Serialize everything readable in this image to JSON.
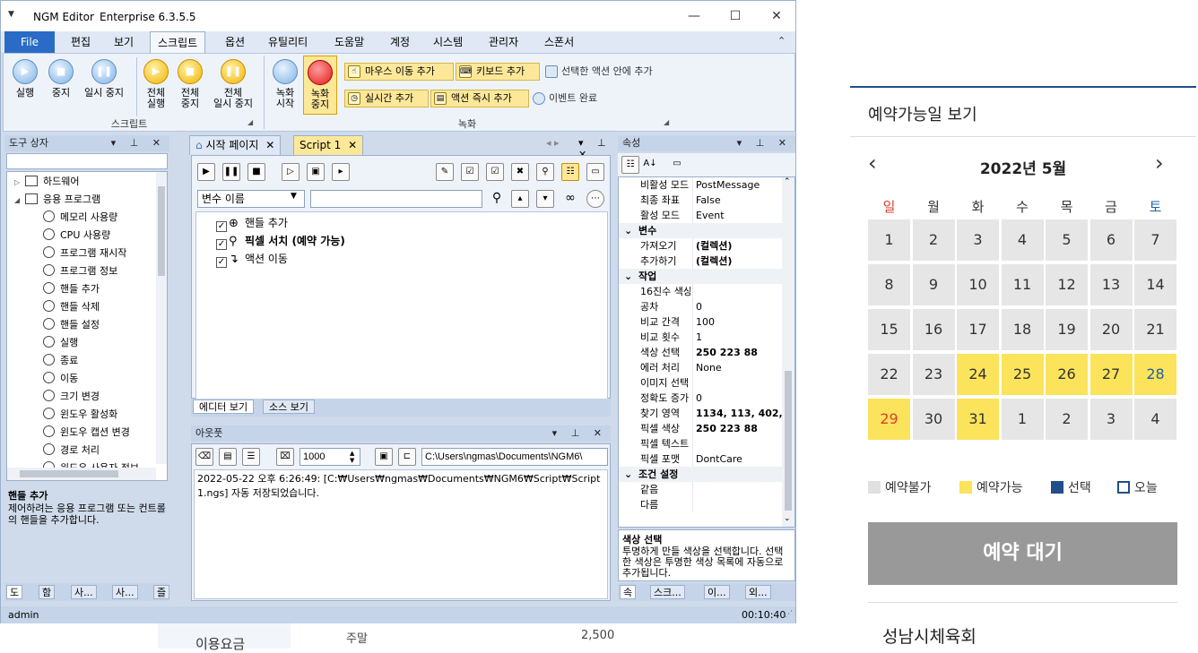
{
  "app": {
    "title": "NGM Editor",
    "edition": "Enterprise 6.3.5.5",
    "window_controls": [
      "—",
      "☐",
      "✕"
    ]
  },
  "menu": [
    "File",
    "편집",
    "보기",
    "스크립트",
    "옵션",
    "유틸리티",
    "도움말",
    "계정",
    "시스템",
    "관리자",
    "스폰서"
  ],
  "ribbon": {
    "script_group": {
      "label": "스크립트",
      "buttons": [
        {
          "line1": "실행",
          "line2": "",
          "icon": "play-icon"
        },
        {
          "line1": "중지",
          "line2": "",
          "icon": "stop-icon"
        },
        {
          "line1": "일시 중지",
          "line2": "",
          "icon": "pause-icon"
        },
        {
          "line1": "전체",
          "line2": "실행",
          "icon": "play-all-icon"
        },
        {
          "line1": "전체",
          "line2": "중지",
          "icon": "stop-all-icon"
        },
        {
          "line1": "전체",
          "line2": "일시 중지",
          "icon": "pause-all-icon"
        }
      ]
    },
    "record_group": {
      "label": "녹화",
      "start": {
        "line1": "녹화",
        "line2": "시작"
      },
      "stop": {
        "line1": "녹화",
        "line2": "중지"
      },
      "add_mouse": "마우스 이동 추가",
      "add_keyboard": "키보드 추가",
      "add_inside": "선택한 액션 안에 추가",
      "add_realtime": "실시간 추가",
      "add_instant": "액션 즉시 추가",
      "event_done": "이벤트 완료"
    }
  },
  "toolbox": {
    "title": "도구 상자",
    "items": [
      {
        "label": "하드웨어",
        "level": 0,
        "expander": "▷"
      },
      {
        "label": "응용 프로그램",
        "level": 0,
        "expander": "◢"
      },
      {
        "label": "메모리 사용량",
        "level": 1
      },
      {
        "label": "CPU 사용량",
        "level": 1
      },
      {
        "label": "프로그램 재시작",
        "level": 1
      },
      {
        "label": "프로그램 정보",
        "level": 1
      },
      {
        "label": "핸들 추가",
        "level": 1
      },
      {
        "label": "핸들 삭제",
        "level": 1
      },
      {
        "label": "핸들 설정",
        "level": 1
      },
      {
        "label": "실행",
        "level": 1
      },
      {
        "label": "종료",
        "level": 1
      },
      {
        "label": "이동",
        "level": 1
      },
      {
        "label": "크기 변경",
        "level": 1
      },
      {
        "label": "윈도우 활성화",
        "level": 1
      },
      {
        "label": "윈도우 캡션 변경",
        "level": 1
      },
      {
        "label": "경로 처리",
        "level": 1
      },
      {
        "label": "윈도우 사용자 정보",
        "level": 1
      }
    ],
    "desc_title": "핸들 추가",
    "desc_text": "제어하려는 응용 프로그램 또는 컨트롤의 핸들을 추가합니다.",
    "bottom_tabs": [
      "도",
      "함",
      "사...",
      "사...",
      "즐"
    ]
  },
  "editor": {
    "tabs": [
      "시작 페이지",
      "Script 1"
    ],
    "variable_combo": "변수 이름",
    "search_value": "",
    "actions": [
      {
        "label": "핸들 추가",
        "bold": false
      },
      {
        "label": "픽셀 서치 (예약 가능)",
        "bold": true
      },
      {
        "label": "액션 이동",
        "bold": false
      }
    ],
    "view_tabs": [
      "에디터 보기",
      "소스 보기"
    ]
  },
  "output": {
    "title": "아웃풋",
    "count": "1000",
    "path": "C:\\Users\\ngmas\\Documents\\NGM6\\",
    "log_line1": "2022-05-22 오후 6:26:49: [C:₩Users₩ngmas₩Documents₩NGM6₩Script₩Script",
    "log_line2": "1.ngs] 자동 저장되었습니다."
  },
  "properties": {
    "title": "속성",
    "rows": [
      {
        "type": "prop",
        "name": "비활성 모드",
        "value": "PostMessage"
      },
      {
        "type": "prop",
        "name": "최종 좌표",
        "value": "False"
      },
      {
        "type": "prop",
        "name": "활성 모드",
        "value": "Event"
      },
      {
        "type": "cat",
        "name": "변수"
      },
      {
        "type": "prop",
        "name": "가져오기",
        "value": "(컬렉션)",
        "bold": true
      },
      {
        "type": "prop",
        "name": "추가하기",
        "value": "(컬렉션)",
        "bold": true
      },
      {
        "type": "cat",
        "name": "작업"
      },
      {
        "type": "prop",
        "name": "16진수 색상",
        "value": ""
      },
      {
        "type": "prop",
        "name": "공차",
        "value": "0"
      },
      {
        "type": "prop",
        "name": "비교 간격",
        "value": "100"
      },
      {
        "type": "prop",
        "name": "비교 횟수",
        "value": "1"
      },
      {
        "type": "prop",
        "name": "색상 선택",
        "value": "250 223 88",
        "bold": true
      },
      {
        "type": "prop",
        "name": "에러 처리",
        "value": "None"
      },
      {
        "type": "prop",
        "name": "이미지 선택",
        "value": ""
      },
      {
        "type": "prop",
        "name": "정확도 증가",
        "value": "0"
      },
      {
        "type": "prop",
        "name": "찾기 영역",
        "value": "1134, 113, 402,",
        "bold": true
      },
      {
        "type": "prop",
        "name": "픽셀 색상",
        "value": "250 223 88",
        "bold": true
      },
      {
        "type": "prop",
        "name": "픽셀 텍스트",
        "value": ""
      },
      {
        "type": "prop",
        "name": "픽셀 포맷",
        "value": "DontCare"
      },
      {
        "type": "cat",
        "name": "조건 설정"
      },
      {
        "type": "prop",
        "name": "같음",
        "value": ""
      },
      {
        "type": "prop",
        "name": "다름",
        "value": ""
      }
    ],
    "desc_title": "색상 선택",
    "desc_text": "투명하게 만들 색상을 선택합니다. 선택한 색상은 투명한 색상 목록에 자동으로 추가됩니다.",
    "bottom_tabs": [
      "속",
      "스크...",
      "이...",
      "외..."
    ]
  },
  "status": {
    "user": "admin",
    "time": "00:10:40"
  },
  "behind": {
    "label_fee": "이용요금",
    "weekend": "주말",
    "price": "2,500"
  },
  "web": {
    "section_title": "예약가능일 보기",
    "month": "2022년 5월",
    "weekdays": [
      "일",
      "월",
      "화",
      "수",
      "목",
      "금",
      "토"
    ],
    "days": [
      {
        "d": "1",
        "s": "n"
      },
      {
        "d": "2",
        "s": "n"
      },
      {
        "d": "3",
        "s": "n"
      },
      {
        "d": "4",
        "s": "n"
      },
      {
        "d": "5",
        "s": "n"
      },
      {
        "d": "6",
        "s": "n"
      },
      {
        "d": "7",
        "s": "n"
      },
      {
        "d": "8",
        "s": "n"
      },
      {
        "d": "9",
        "s": "n"
      },
      {
        "d": "10",
        "s": "n"
      },
      {
        "d": "11",
        "s": "n"
      },
      {
        "d": "12",
        "s": "n"
      },
      {
        "d": "13",
        "s": "n"
      },
      {
        "d": "14",
        "s": "n"
      },
      {
        "d": "15",
        "s": "n"
      },
      {
        "d": "16",
        "s": "n"
      },
      {
        "d": "17",
        "s": "n"
      },
      {
        "d": "18",
        "s": "n"
      },
      {
        "d": "19",
        "s": "n"
      },
      {
        "d": "20",
        "s": "n"
      },
      {
        "d": "21",
        "s": "n"
      },
      {
        "d": "22",
        "s": "n"
      },
      {
        "d": "23",
        "s": "n"
      },
      {
        "d": "24",
        "s": "a"
      },
      {
        "d": "25",
        "s": "a"
      },
      {
        "d": "26",
        "s": "a"
      },
      {
        "d": "27",
        "s": "a"
      },
      {
        "d": "28",
        "s": "a"
      },
      {
        "d": "29",
        "s": "a"
      },
      {
        "d": "30",
        "s": "n"
      },
      {
        "d": "31",
        "s": "a"
      },
      {
        "d": "1",
        "s": "n"
      },
      {
        "d": "2",
        "s": "n"
      },
      {
        "d": "3",
        "s": "n"
      },
      {
        "d": "4",
        "s": "n"
      }
    ],
    "legend": [
      "예약불가",
      "예약가능",
      "선택",
      "오늘"
    ],
    "reserve_button": "예약 대기",
    "facility": "성남시체육회",
    "colors": {
      "unavailable": "#e6e6e6",
      "available": "#fbe35b",
      "selected": "#1f4e89",
      "sunday": "#d9412b",
      "saturday": "#1f5fa8"
    }
  }
}
